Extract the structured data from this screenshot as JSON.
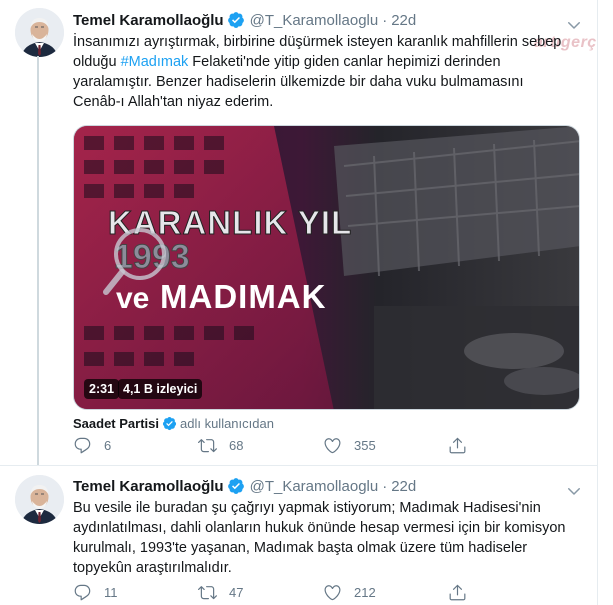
{
  "watermark": "artıgerçek",
  "tweets": [
    {
      "name": "Temel Karamollaoğlu",
      "handle": "@T_Karamollaoglu",
      "dot": "·",
      "time": "22d",
      "text_before_hashtag": "İnsanımızı ayrıştırmak, birbirine düşürmek isteyen karanlık mahfillerin sebep olduğu ",
      "hashtag": "#Madımak",
      "text_after_hashtag": " Felaketi'nde yitip giden canlar hepimizi derinden yaralamıştır. Benzer hadiselerin ülkemizde bir daha vuku bulmamasını Cenâb-ı Allah'tan niyaz ederim.",
      "video": {
        "duration": "2:31",
        "views": "4,1 B izleyici",
        "headline_line1": "KARANLIK YIL",
        "headline_year": "1993",
        "headline_ve": "ve",
        "headline_line3": "MADIMAK"
      },
      "attribution_author": "Saadet Partisi",
      "attribution_via": "adlı kullanıcıdan",
      "replies": "6",
      "retweets": "68",
      "likes": "355"
    },
    {
      "name": "Temel Karamollaoğlu",
      "handle": "@T_Karamollaoglu",
      "dot": "·",
      "time": "22d",
      "text": "Bu vesile ile buradan şu çağrıyı yapmak istiyorum; Madımak Hadisesi'nin aydınlatılması, dahli olanların hukuk önünde hesap vermesi için bir komisyon kurulmalı, 1993'te yaşanan, Madımak başta olmak üzere tüm hadiseler topyekûn araştırılmalıdır.",
      "replies": "11",
      "retweets": "47",
      "likes": "212"
    }
  ],
  "colors": {
    "accent": "#1da1f2",
    "muted": "#657786",
    "text": "#14171a",
    "border": "#e6ecf0"
  }
}
